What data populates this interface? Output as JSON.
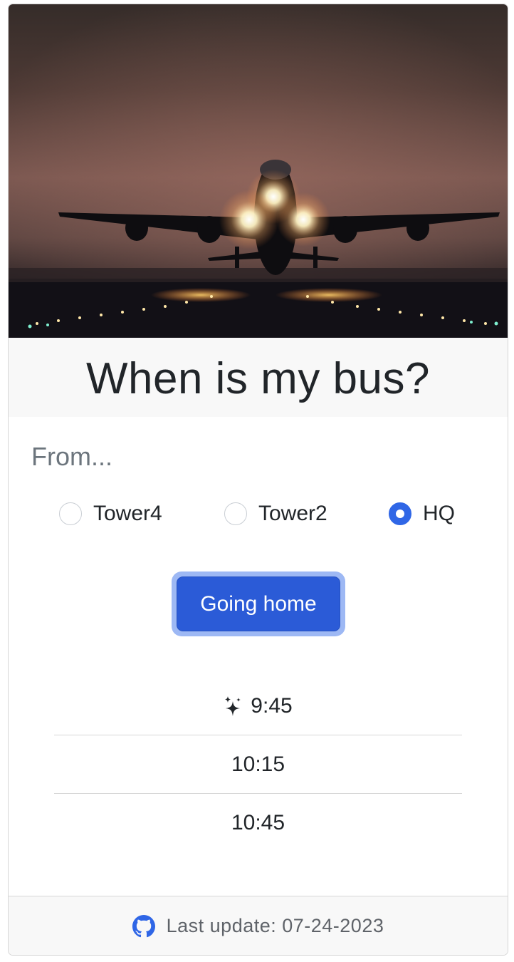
{
  "hero": {
    "image": "airplane-takeoff-at-dusk"
  },
  "title": "When is my bus?",
  "from_label": "From...",
  "locations": [
    {
      "label": "Tower4",
      "checked": false
    },
    {
      "label": "Tower2",
      "checked": false
    },
    {
      "label": "HQ",
      "checked": true
    }
  ],
  "direction_button": "Going home",
  "times": [
    {
      "time": "9:45",
      "icon": "sparkles-icon"
    },
    {
      "time": "10:15"
    },
    {
      "time": "10:45"
    }
  ],
  "footer": {
    "icon": "github-icon",
    "last_update": "Last update: 07-24-2023"
  },
  "colors": {
    "accent": "#2b5bd7",
    "accent_focus_ring": "#9db8f4",
    "radio_checked": "#2f66e6",
    "muted_text": "#6c757d"
  }
}
